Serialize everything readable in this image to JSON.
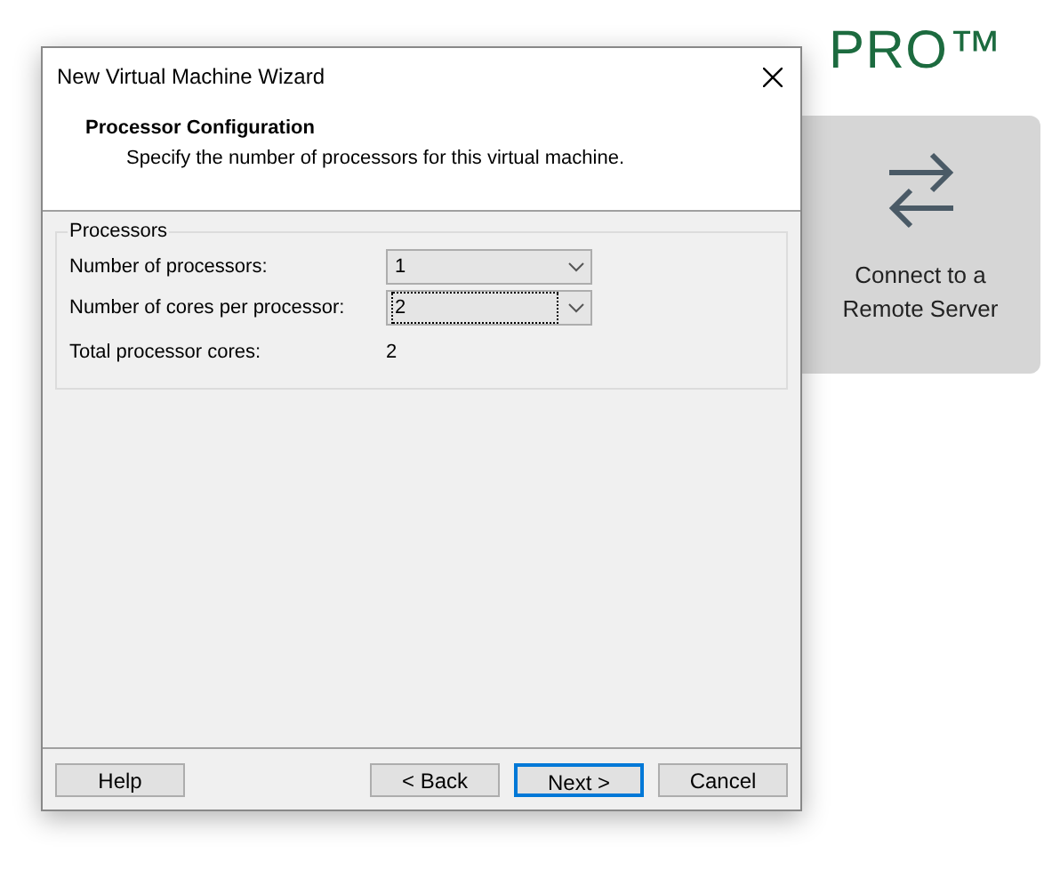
{
  "background": {
    "heading": "PRO™",
    "card": {
      "label": "Connect to a Remote Server"
    }
  },
  "window": {
    "title": "New Virtual Machine Wizard"
  },
  "header": {
    "title": "Processor Configuration",
    "subtitle": "Specify the number of processors for this virtual machine."
  },
  "processors": {
    "legend": "Processors",
    "fields": [
      {
        "label": "Number of processors:",
        "value": "1",
        "focused": false
      },
      {
        "label": "Number of cores per processor:",
        "value": "2",
        "focused": true
      }
    ],
    "total": {
      "label": "Total processor cores:",
      "value": "2"
    }
  },
  "buttons": [
    {
      "label": "Help",
      "default": false
    },
    {
      "label": "< Back",
      "default": false
    },
    {
      "label": "Next >",
      "default": true
    },
    {
      "label": "Cancel",
      "default": false
    }
  ]
}
